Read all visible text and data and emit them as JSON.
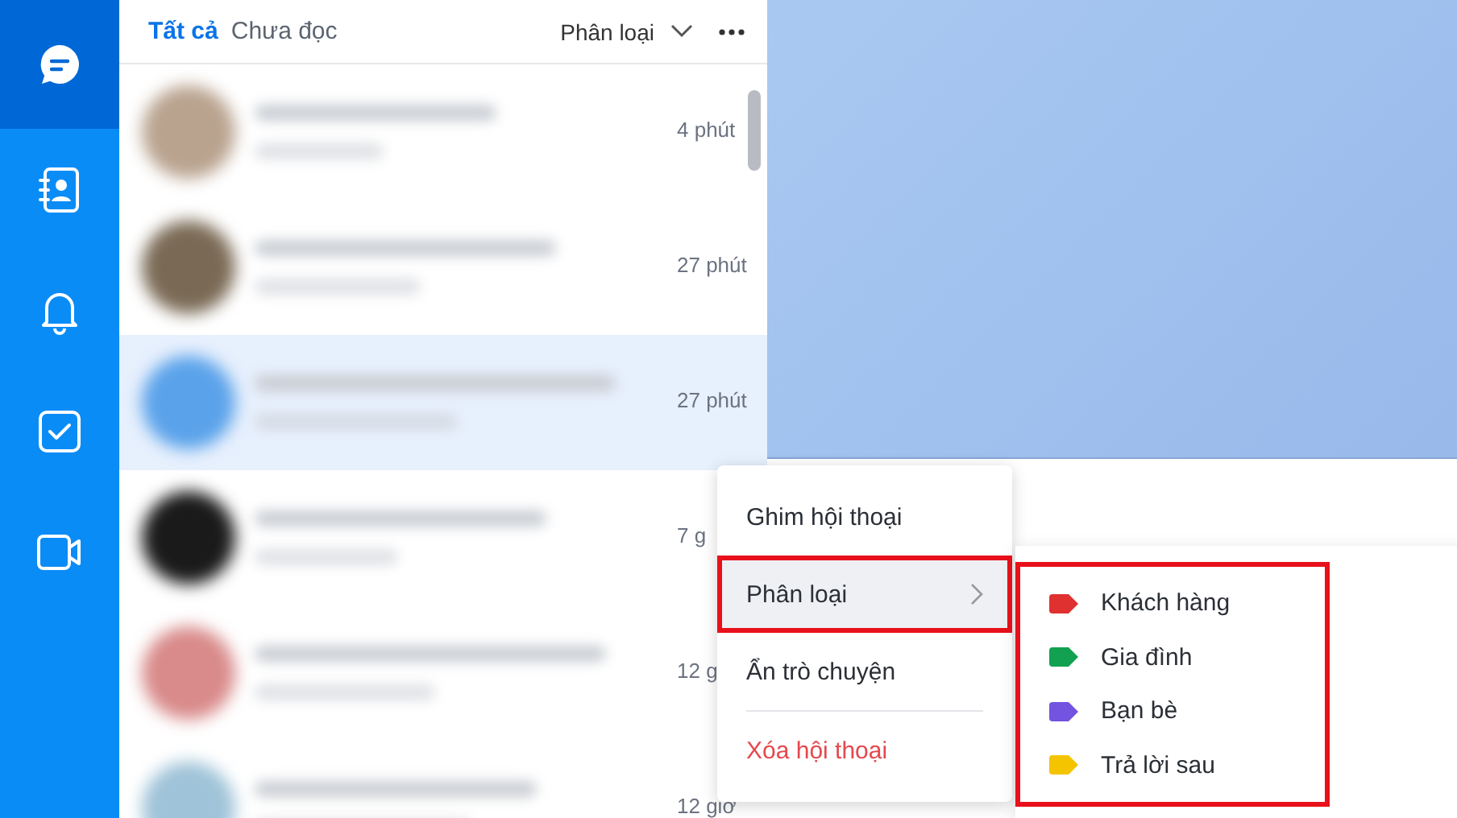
{
  "sidebar": {
    "items": [
      {
        "kind": "chat",
        "selected": true
      },
      {
        "kind": "contacts",
        "selected": false
      },
      {
        "kind": "bell",
        "selected": false
      },
      {
        "kind": "todo",
        "selected": false
      },
      {
        "kind": "video",
        "selected": false
      }
    ]
  },
  "tabs": [
    {
      "label": "Tất cả",
      "selected": true
    },
    {
      "label": "Chưa đọc",
      "selected": false
    }
  ],
  "filter": {
    "label": "Phân loại"
  },
  "conversations": [
    {
      "time": "4 phút",
      "selected": false
    },
    {
      "time": "27 phút",
      "selected": false
    },
    {
      "time": "27 phút",
      "selected": true
    },
    {
      "time": "7 g",
      "selected": false
    },
    {
      "time": "12 g",
      "selected": false
    },
    {
      "time": "12 giờ",
      "selected": false
    }
  ],
  "context_menu": {
    "items": [
      {
        "label": "Ghim hội thoại",
        "kind": "normal",
        "selected": false
      },
      {
        "label": "Phân loại",
        "kind": "submenu",
        "selected": true
      },
      {
        "label": "Ẩn trò chuyện",
        "kind": "normal",
        "selected": false
      },
      {
        "label": "Xóa hội thoại",
        "kind": "danger",
        "selected": false
      }
    ]
  },
  "submenu": {
    "items": [
      {
        "label": "Khách hàng",
        "color": "#e03131"
      },
      {
        "label": "Gia đình",
        "color": "#12a150"
      },
      {
        "label": "Bạn bè",
        "color": "#7254e0"
      },
      {
        "label": "Trả lời sau",
        "color": "#f5c400"
      }
    ]
  }
}
